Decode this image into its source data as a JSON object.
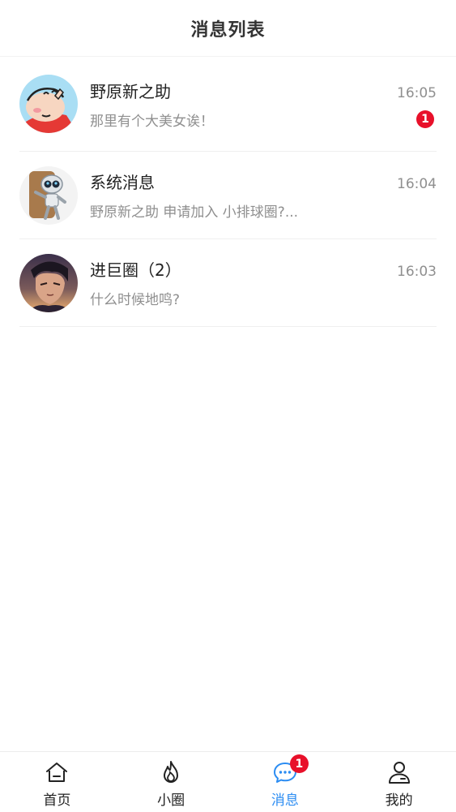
{
  "header": {
    "title": "消息列表"
  },
  "conversations": [
    {
      "name": "野原新之助",
      "time": "16:05",
      "preview": "那里有个大美女诶！",
      "unread": "1",
      "avatar_icon": "cartoon-boy-avatar"
    },
    {
      "name": "系统消息",
      "time": "16:04",
      "preview": "野原新之助 申请加入 小排球圈?...",
      "avatar_icon": "robot-avatar"
    },
    {
      "name": "进巨圈（2）",
      "time": "16:03",
      "preview": "什么时候地鸣?",
      "avatar_icon": "anime-character-avatar"
    }
  ],
  "tabbar": {
    "tabs": [
      {
        "label": "首页",
        "icon": "home-icon"
      },
      {
        "label": "小圈",
        "icon": "flame-icon"
      },
      {
        "label": "消息",
        "icon": "chat-icon",
        "badge": "1",
        "active": true
      },
      {
        "label": "我的",
        "icon": "person-icon"
      }
    ]
  },
  "colors": {
    "accent": "#2b8cf2",
    "badge": "#e8102a",
    "muted_text": "#8f8f8f"
  }
}
